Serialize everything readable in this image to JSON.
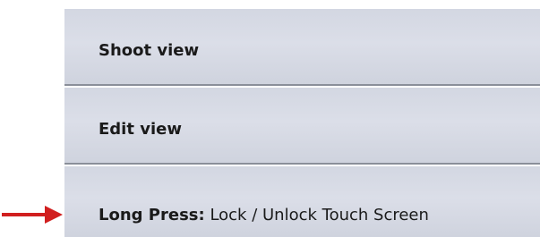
{
  "menu": {
    "items": [
      {
        "label": "Shoot view"
      },
      {
        "label": "Edit view"
      },
      {
        "label_bold": "Long Press:",
        "label_rest": " Lock / Unlock Touch Screen"
      }
    ]
  },
  "arrow": {
    "color": "#d11f1f"
  },
  "icons": [
    "right-arrow-icon"
  ]
}
